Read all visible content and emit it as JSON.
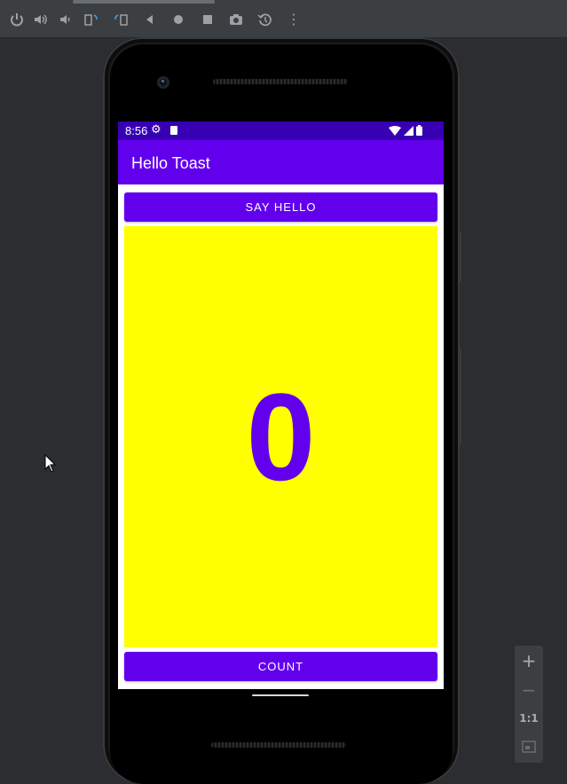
{
  "toolbar": {
    "icons": [
      "power-icon",
      "volume-up-icon",
      "volume-down-icon",
      "rotate-left-icon",
      "rotate-right-icon",
      "back-icon",
      "home-icon",
      "overview-icon",
      "screenshot-icon",
      "snapshot-icon",
      "more-icon"
    ],
    "more_glyph": "⋮"
  },
  "device": {
    "status_bar": {
      "time": "8:56"
    },
    "app_bar": {
      "title": "Hello Toast"
    },
    "say_hello_button": {
      "label": "SAY HELLO"
    },
    "count_display": {
      "value": "0"
    },
    "count_button": {
      "label": "COUNT"
    }
  },
  "zoom_controls": {
    "zoom_in": "+",
    "zoom_out": "−",
    "actual_size": "1:1"
  },
  "colors": {
    "primary": "#6200ee",
    "primary_dark": "#3700b3",
    "count_background": "#ffff00",
    "window_background": "#2b2d30"
  }
}
